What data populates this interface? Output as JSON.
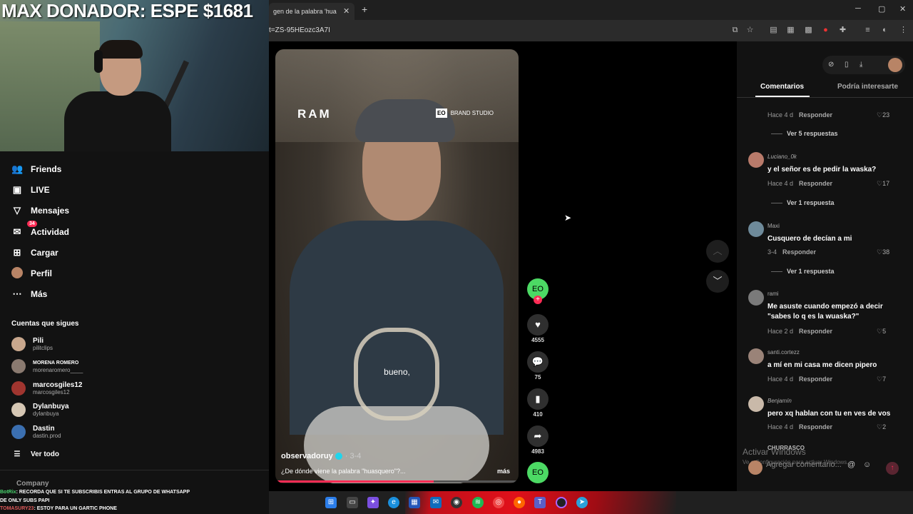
{
  "overlay": {
    "donor_text": "MAX DONADOR: ESPE $1681"
  },
  "browser": {
    "tab_title": "gen de la palabra 'hua",
    "tab_close": "✕",
    "new_tab": "+",
    "url": "t=ZS-95HEozc3A7I",
    "win_min": "─",
    "win_max": "▢",
    "win_close": "✕"
  },
  "sidebar": {
    "nav": [
      {
        "label": "Friends",
        "icon": "friends-icon"
      },
      {
        "label": "LIVE",
        "icon": "live-icon"
      },
      {
        "label": "Mensajes",
        "icon": "messages-icon"
      },
      {
        "label": "Actividad",
        "icon": "activity-icon",
        "badge": "34"
      },
      {
        "label": "Cargar",
        "icon": "upload-icon"
      },
      {
        "label": "Perfil",
        "icon": "profile-icon"
      },
      {
        "label": "Más",
        "icon": "more-icon"
      }
    ],
    "following_title": "Cuentas que sigues",
    "following": [
      {
        "name": "Pili",
        "user": "pilitclips"
      },
      {
        "name": "MORENA ROMERO",
        "user": "morenaromero____"
      },
      {
        "name": "marcosgiles12",
        "user": "marcosgiles12"
      },
      {
        "name": "Dylanbuya",
        "user": "dylanbuya"
      },
      {
        "name": "Dastin",
        "user": "dastin.prod"
      }
    ],
    "see_all": "Ver todo",
    "company": "Company"
  },
  "chat": [
    {
      "name": "BotRix",
      "text": ": RECORDA QUE SI TE SUBSCRIBIS ENTRAS AL GRUPO DE WHATSAPP"
    },
    {
      "name": "",
      "text": "DE ONLY SUBS PAPI"
    },
    {
      "name": "TOMASURY23",
      "text": ": ESTOY PARA UN GARTIC PHONE"
    }
  ],
  "video": {
    "brand": "RAM",
    "eo_badge": "EO",
    "studio": "BRAND STUDIO",
    "caption": "bueno,",
    "author": "observadoruy",
    "date": "· 3-4",
    "description": "¿De dónde viene la palabra \"huasquero\"?...",
    "more": "más",
    "progress": 0.65
  },
  "actions": {
    "avatar_label": "EO",
    "likes": "4555",
    "comments": "75",
    "saves": "410",
    "shares": "4983"
  },
  "comments_panel": {
    "tabs": [
      "Comentarios",
      "Podría interesarte"
    ],
    "top_partial": {
      "meta": "Hace 4 d",
      "reply": "Responder",
      "likes": "23"
    },
    "comments": [
      {
        "user": "Luciano_0k",
        "text": "y el señor es de pedir la waska?",
        "meta": "Hace 4 d",
        "reply": "Responder",
        "likes": "17",
        "more": "Ver 1 respuesta"
      },
      {
        "user": "Maxi",
        "text": "Cusquero de decían a mi",
        "meta": "3-4",
        "reply": "Responder",
        "likes": "38",
        "more": "Ver 1 respuesta"
      },
      {
        "user": "rami",
        "text": "Me asuste cuando empezó a decir \"sabes lo q es la wuaska?\"",
        "meta": "Hace 2 d",
        "reply": "Responder",
        "likes": "5"
      },
      {
        "user": "santi.cortezz",
        "text": "a mí en mi casa me dicen pipero",
        "meta": "Hace 4 d",
        "reply": "Responder",
        "likes": "7"
      },
      {
        "user": "Benjamín",
        "text": "pero xq hablan con tu en ves de vos",
        "meta": "Hace 4 d",
        "reply": "Responder",
        "likes": "2"
      }
    ],
    "first_more": "Ver 5 respuestas",
    "partial_user": "CHURRASCO",
    "add_comment": "Agregar comentario...",
    "activate_windows": "Activar Windows",
    "activate_sub": "Ve a Configuración para activar Windows."
  },
  "colors": {
    "accent": "#fe2c55",
    "eo_green": "#4cd964",
    "panel_bg": "#121212"
  }
}
